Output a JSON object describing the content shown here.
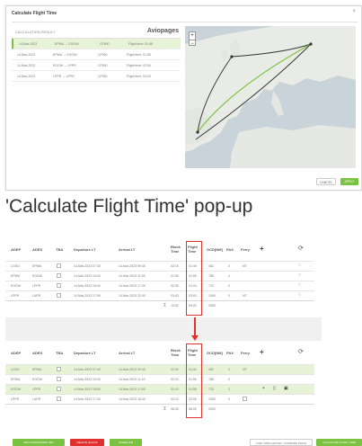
{
  "popup": {
    "title": "Calculate Flight Time",
    "close": "×",
    "legs_header": "CALCULATION RESULT",
    "brand": "Aviopages",
    "legs": [
      {
        "date": "14-Mar-2023",
        "route": "EPWA → EGGW",
        "ac": "CF500",
        "info": "Flight time: 01:55"
      },
      {
        "date": "14-Mar-2023",
        "route": "EPWA → EGGW",
        "ac": "CF500",
        "info": "Flight time: 01:55"
      },
      {
        "date": "14-Mar-2023",
        "route": "EGGW → LPPR",
        "ac": "CF500",
        "info": "Flight time: 02:04"
      },
      {
        "date": "14-Mar-2023",
        "route": "LPPR → LPPR",
        "ac": "CF500",
        "info": "Flight time: 03:03"
      }
    ],
    "zoom_in": "+",
    "zoom_out": "−",
    "cancel": "CANCEL",
    "apply": "APPLY"
  },
  "caption": "'Calculate Flight Time' pop-up",
  "table_headers": {
    "adep": "ADEP",
    "ades": "ADES",
    "tba": "TBA",
    "dep": "Departure LT",
    "arr": "Arrival LT",
    "block": "Block\nTime",
    "flight": "Flight\nTime",
    "gcd": "GCD[NM]",
    "pax": "PAX",
    "ferry": "Ferry",
    "plus": "+",
    "refresh": "⟳"
  },
  "table_before": {
    "rows": [
      {
        "adep": "LGSO",
        "ades": "EPWA",
        "dep": "14-Mar-2023 07:30",
        "arr": "14-Mar-2023 09:45",
        "block": "02:15",
        "flight": "01:49",
        "gcd": "482",
        "pax": "0",
        "ferry": "NT"
      },
      {
        "adep": "EPWA",
        "ades": "EGGW",
        "dep": "14-Mar-2023 10:00",
        "arr": "14-Mar-2023 11:55",
        "block": "01:55",
        "flight": "02:05",
        "gcd": "788",
        "pax": "4",
        "ferry": ""
      },
      {
        "adep": "EGGW",
        "ades": "LPPR",
        "dep": "14-Mar-2023 15:00",
        "arr": "14-Mar-2023 17:05",
        "block": "02:05",
        "flight": "02:04",
        "gcd": "723",
        "pax": "2",
        "ferry": ""
      },
      {
        "adep": "LPPR",
        "ades": "LAPR",
        "dep": "14-Mar-2023 17:55",
        "arr": "14-Mar-2023 22:00",
        "block": "03:03",
        "flight": "03:03",
        "gcd": "1090",
        "pax": "0",
        "ferry": "NT"
      }
    ],
    "total_label": "Σ",
    "total_block": "10:53",
    "total_flight": "09:20",
    "total_gcd": "3090"
  },
  "table_after": {
    "rows": [
      {
        "adep": "LGSO",
        "ades": "EPWA",
        "dep": "14-Mar-2023 07:40",
        "arr": "14-Mar-2023 09:40",
        "block": "02:00",
        "flight": "01:40",
        "gcd": "482",
        "pax": "0",
        "ferry": "NT"
      },
      {
        "adep": "EPWA",
        "ades": "EGGW",
        "dep": "14-Mar-2023 10:00",
        "arr": "14-Mar-2023 11:10",
        "block": "02:10",
        "flight": "01:55",
        "gcd": "788",
        "pax": "2",
        "ferry": ""
      },
      {
        "adep": "EGGW",
        "ades": "LPPR",
        "dep": "14-Mar-2023 15:50",
        "arr": "14-Mar-2023 17:50",
        "block": "02:10",
        "flight": "01:55",
        "gcd": "723",
        "pax": "2",
        "ferry": ""
      },
      {
        "adep": "LPPR",
        "ades": "LAPR",
        "dep": "14-Mar-2023 17:40",
        "arr": "14-Mar-2023 18:40",
        "block": "02:10",
        "flight": "02:05",
        "gcd": "1090",
        "pax": "0",
        "ferry": ""
      }
    ],
    "total_label": "Σ",
    "total_block": "08:30",
    "total_flight": "08:05",
    "total_gcd": "3090"
  },
  "buttons": {
    "add": "ADD POSITIONING LEG",
    "delete": "DELETE QUOTE",
    "schedule": "SCHEDULE",
    "preview": "FIND SUBCHARTER / COMPARE PRICE",
    "calc": "CALCULATE FLIGHT TIME"
  },
  "colors": {
    "accent": "#7cc242",
    "highlight": "#e0312f",
    "row_highlight": "#e7f3d6"
  },
  "icons": [
    "close-icon",
    "zoom-in-icon",
    "zoom-out-icon",
    "plus-icon",
    "refresh-icon",
    "down-arrow-icon"
  ]
}
